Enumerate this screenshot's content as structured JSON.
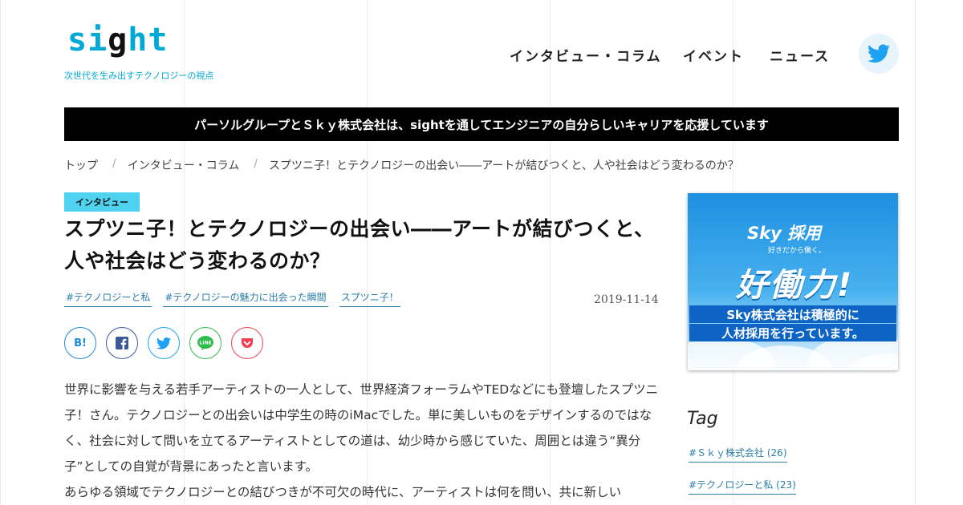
{
  "header": {
    "logo_prefix": "si",
    "logo_g": "g",
    "logo_suffix": "ht",
    "tagline": "次世代を生み出すテクノロジーの視点",
    "nav": [
      "インタビュー・コラム",
      "イベント",
      "ニュース"
    ]
  },
  "banner": {
    "text": "パーソルグループとＳｋｙ株式会社は、sightを通してエンジニアの自分らしいキャリアを応援しています"
  },
  "breadcrumb": {
    "items": [
      "トップ",
      "インタビュー・コラム",
      "スプツニ子！とテクノロジーの出会い――アートが結びつくと、人や社会はどう変わるのか？"
    ],
    "separator": "/"
  },
  "article": {
    "category": "インタビュー",
    "title_line1": "スプツニ子！とテクノロジーの出会い――アートが結びつくと、",
    "title_line2": "人や社会はどう変わるのか？",
    "tags": [
      "#テクノロジーと私",
      "#テクノロジーの魅力に出会った瞬間",
      "スプツニ子！"
    ],
    "date": "2019-11-14",
    "share": {
      "hatena_label": "B!",
      "line_label": "LINE"
    },
    "paragraphs": [
      "世界に影響を与える若手アーティストの一人として、世界経済フォーラムやTEDなどにも登壇したスプツニ子！さん。テクノロジーとの出会いは中学生の時のiMacでした。単に美しいものをデザインするのではなく、社会に対して問いを立てるアーティストとしての道は、幼少時から感じていた、周囲とは違う“異分子”としての自覚が背景にあったと言います。",
      "あらゆる領域でテクノロジーとの結びつきが不可欠の時代に、アーティストは何を問い、共に新しい"
    ]
  },
  "sidebar": {
    "ad": {
      "logo": "Sky 採用",
      "small": "好きだから働く。",
      "big": "好働力!",
      "line1": "Sky株式会社は積極的に",
      "line2": "人材採用を行っています。"
    },
    "tag_heading": "Tag",
    "tags": [
      "#Ｓｋｙ株式会社 (26)",
      "#テクノロジーと私 (23)"
    ]
  },
  "colors": {
    "accent": "#00a8d6",
    "badge": "#4fd1f0",
    "link": "#2a7ea8",
    "banner_bg": "#000000",
    "twitter": "#1da1f2",
    "facebook": "#3b5998",
    "line": "#2ebd4a",
    "pocket": "#ef4056"
  },
  "icons": [
    "twitter-icon",
    "hatena-icon",
    "facebook-icon",
    "twitter-icon",
    "line-icon",
    "pocket-icon"
  ]
}
